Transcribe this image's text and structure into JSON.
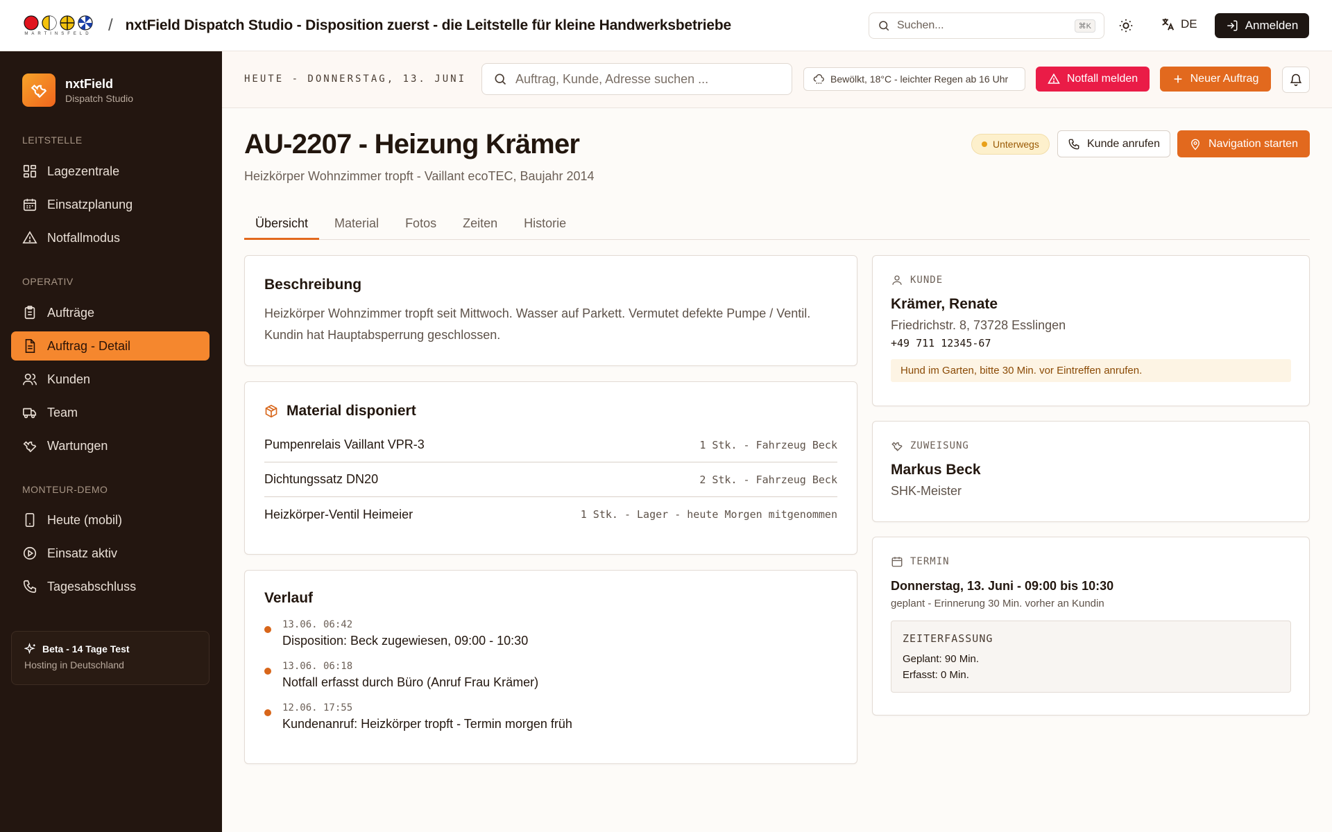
{
  "topbar": {
    "logo_text": "MARTINSFELD",
    "separator": "/",
    "app_title": "nxtField Dispatch Studio - Disposition zuerst - die Leitstelle für kleine Handwerksbetriebe",
    "search_placeholder": "Suchen...",
    "search_shortcut": "⌘K",
    "language": "DE",
    "login_label": "Anmelden"
  },
  "sidebar": {
    "brand_name": "nxtField",
    "brand_sub": "Dispatch Studio",
    "sections": [
      {
        "title": "LEITSTELLE",
        "items": [
          {
            "label": "Lagezentrale",
            "icon": "dashboard-icon"
          },
          {
            "label": "Einsatzplanung",
            "icon": "calendar-icon"
          },
          {
            "label": "Notfallmodus",
            "icon": "warning-icon"
          }
        ]
      },
      {
        "title": "OPERATIV",
        "items": [
          {
            "label": "Aufträge",
            "icon": "clipboard-icon"
          },
          {
            "label": "Auftrag - Detail",
            "icon": "document-icon",
            "active": true
          },
          {
            "label": "Kunden",
            "icon": "users-icon"
          },
          {
            "label": "Team",
            "icon": "truck-icon"
          },
          {
            "label": "Wartungen",
            "icon": "wrench-icon"
          }
        ]
      },
      {
        "title": "MONTEUR-DEMO",
        "items": [
          {
            "label": "Heute (mobil)",
            "icon": "phone-device-icon"
          },
          {
            "label": "Einsatz aktiv",
            "icon": "play-circle-icon"
          },
          {
            "label": "Tagesabschluss",
            "icon": "phone-icon"
          }
        ]
      }
    ],
    "beta_title": "Beta - 14 Tage Test",
    "beta_sub": "Hosting in Deutschland"
  },
  "header": {
    "date": "HEUTE - DONNERSTAG, 13. JUNI",
    "search_placeholder": "Auftrag, Kunde, Adresse suchen ...",
    "weather": "Bewölkt, 18°C - leichter Regen ab 16 Uhr",
    "emergency_label": "Notfall melden",
    "new_order_label": "Neuer Auftrag"
  },
  "order": {
    "title": "AU-2207 - Heizung Krämer",
    "subtitle": "Heizkörper Wohnzimmer tropft - Vaillant ecoTEC, Baujahr 2014",
    "status": "Unterwegs",
    "call_label": "Kunde anrufen",
    "navigate_label": "Navigation starten"
  },
  "tabs": [
    "Übersicht",
    "Material",
    "Fotos",
    "Zeiten",
    "Historie"
  ],
  "description": {
    "title": "Beschreibung",
    "text": "Heizkörper Wohnzimmer tropft seit Mittwoch. Wasser auf Parkett. Vermutet defekte Pumpe / Ventil. Kundin hat Hauptabsperrung geschlossen."
  },
  "material": {
    "title": "Material disponiert",
    "items": [
      {
        "name": "Pumpenrelais Vaillant VPR-3",
        "qty": "1 Stk. - Fahrzeug Beck"
      },
      {
        "name": "Dichtungssatz DN20",
        "qty": "2 Stk. - Fahrzeug Beck"
      },
      {
        "name": "Heizkörper-Ventil Heimeier",
        "qty": "1 Stk. - Lager - heute Morgen mitgenommen"
      }
    ]
  },
  "history": {
    "title": "Verlauf",
    "items": [
      {
        "time": "13.06. 06:42",
        "text": "Disposition: Beck zugewiesen, 09:00 - 10:30"
      },
      {
        "time": "13.06. 06:18",
        "text": "Notfall erfasst durch Büro (Anruf Frau Krämer)"
      },
      {
        "time": "12.06. 17:55",
        "text": "Kundenanruf: Heizkörper tropft - Termin morgen früh"
      }
    ]
  },
  "customer": {
    "label": "KUNDE",
    "name": "Krämer, Renate",
    "address": "Friedrichstr. 8, 73728 Esslingen",
    "phone": "+49 711 12345-67",
    "note": "Hund im Garten, bitte 30 Min. vor Eintreffen anrufen."
  },
  "assignment": {
    "label": "ZUWEISUNG",
    "name": "Markus Beck",
    "role": "SHK-Meister"
  },
  "appointment": {
    "label": "TERMIN",
    "datetime": "Donnerstag, 13. Juni - 09:00 bis 10:30",
    "sub": "geplant - Erinnerung 30 Min. vorher an Kundin",
    "time_label": "ZEITERFASSUNG",
    "planned": "Geplant: 90 Min.",
    "recorded": "Erfasst: 0 Min."
  },
  "colors": {
    "accent": "#e2691e",
    "sidebar_bg": "#231610",
    "emergency": "#ea1c47",
    "status_dot": "#e8a019"
  }
}
